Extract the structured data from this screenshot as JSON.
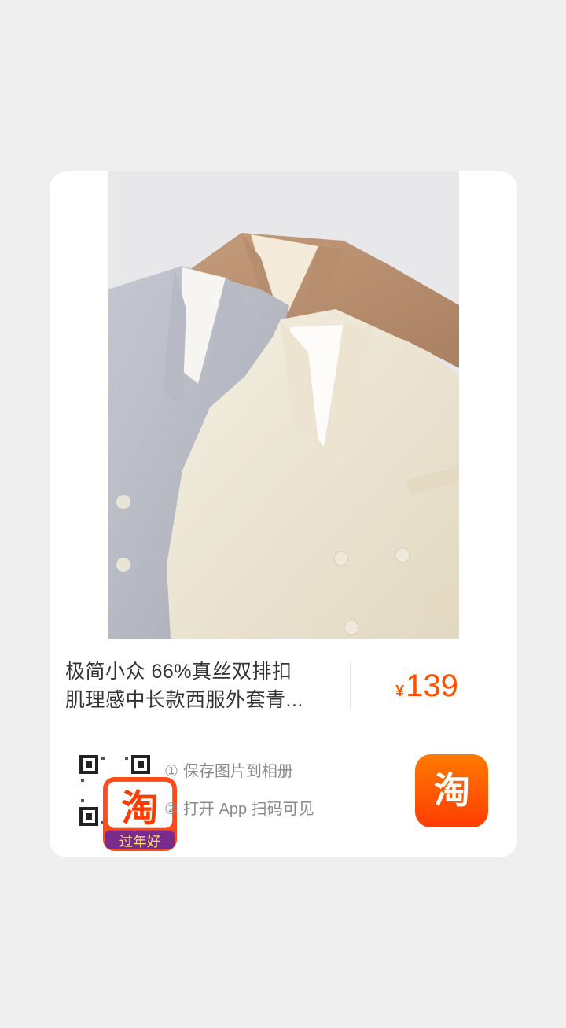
{
  "product": {
    "title_line1": "极简小众 66%真丝双排扣",
    "title_line2": "肌理感中长款西服外套青...",
    "price_symbol": "¥",
    "price_value": "139"
  },
  "share": {
    "step1_num": "①",
    "step1_text": "保存图片到相册",
    "step2_num": "②",
    "step2_text": "打开 App 扫码可见"
  },
  "qr": {
    "badge_glyph": "淘",
    "badge_caption": "过年好"
  },
  "logo": {
    "glyph": "淘"
  },
  "colors": {
    "accent": "#ff5000",
    "logo_gradient_top": "#ff7a00",
    "logo_gradient_bottom": "#ff3d00"
  },
  "icons": {
    "qr": "qr-code-icon",
    "app": "taobao-logo-icon"
  }
}
